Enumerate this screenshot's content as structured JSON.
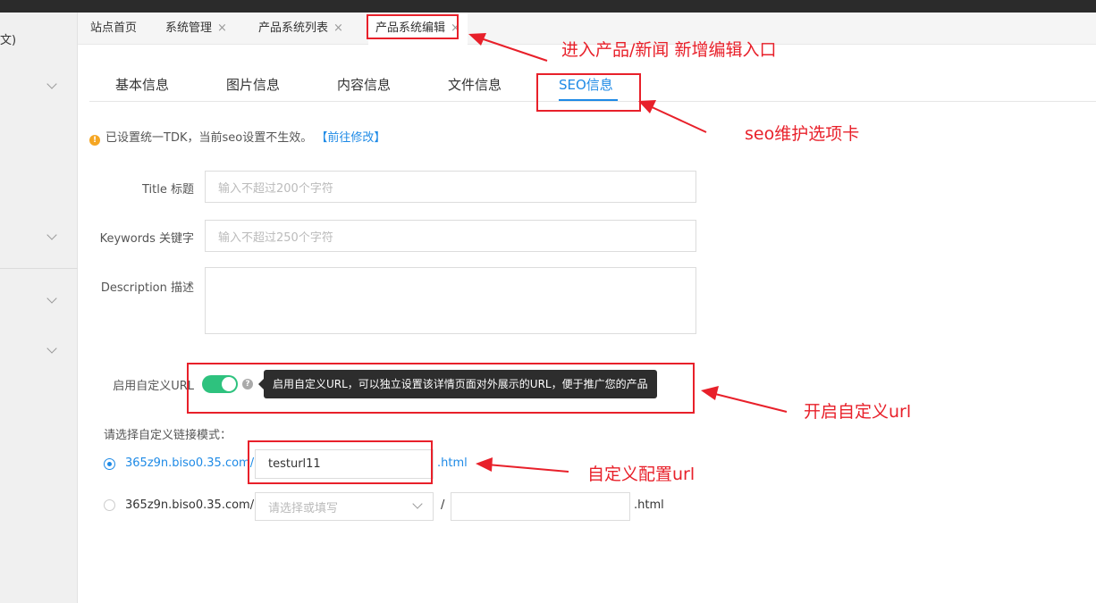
{
  "sidebar": {
    "top_fragment": "文)",
    "chevrons": [
      "chevron-down-icon",
      "chevron-down-icon",
      "chevron-down-icon",
      "chevron-down-icon"
    ]
  },
  "tabs": [
    {
      "label": "站点首页",
      "closable": false
    },
    {
      "label": "系统管理",
      "closable": true
    },
    {
      "label": "产品系统列表",
      "closable": true
    },
    {
      "label": "产品系统编辑",
      "closable": true,
      "active": true
    }
  ],
  "close_glyph": "×",
  "subtabs": [
    "基本信息",
    "图片信息",
    "内容信息",
    "文件信息",
    "SEO信息"
  ],
  "active_subtab": "SEO信息",
  "notice": {
    "text": "已设置统一TDK，当前seo设置不生效。",
    "link": "【前往修改】",
    "icon": "warning-icon",
    "icon_glyph": "!"
  },
  "form": {
    "title_label": "Title 标题",
    "title_placeholder": "输入不超过200个字符",
    "keywords_label": "Keywords 关键字",
    "keywords_placeholder": "输入不超过250个字符",
    "description_label": "Description 描述",
    "custom_url_label": "启用自定义URL",
    "custom_url_enabled": true,
    "help_glyph": "?",
    "tooltip": "启用自定义URL，可以独立设置该详情页面对外展示的URL，便于推广您的产品",
    "mode_label": "请选择自定义链接模式：",
    "mode1_domain": "365z9n.biso0.35.com/",
    "mode1_value": "testurl11",
    "mode1_suffix": ".html",
    "mode2_domain": "365z9n.biso0.35.com/",
    "mode2_select_placeholder": "请选择或填写",
    "mode2_sep": "/",
    "mode2_suffix": ".html"
  },
  "annotations": {
    "a1": "进入产品/新闻  新增编辑入口",
    "a2": "seo维护选项卡",
    "a3": "开启自定义url",
    "a4": "自定义配置url"
  },
  "colors": {
    "accent": "#1e8ae6",
    "annotation": "#e8202a",
    "switch_on": "#2ec27e",
    "warning": "#f5a623"
  }
}
